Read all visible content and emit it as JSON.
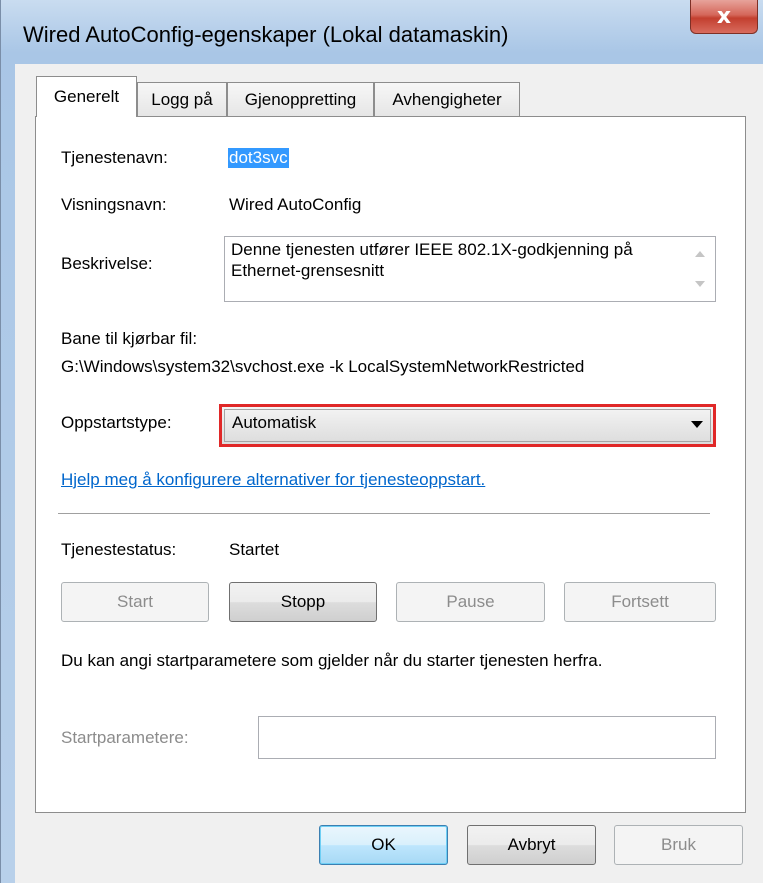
{
  "window": {
    "title": "Wired AutoConfig-egenskaper (Lokal datamaskin)",
    "close_label": "x"
  },
  "tabs": [
    {
      "label": "Generelt"
    },
    {
      "label": "Logg på"
    },
    {
      "label": "Gjenoppretting"
    },
    {
      "label": "Avhengigheter"
    }
  ],
  "general": {
    "service_name_label": "Tjenestenavn:",
    "service_name_value": "dot3svc",
    "display_name_label": "Visningsnavn:",
    "display_name_value": "Wired AutoConfig",
    "description_label": "Beskrivelse:",
    "description_value": "Denne tjenesten utfører IEEE 802.1X-godkjenning på Ethernet-grensesnitt",
    "path_label": "Bane til kjørbar fil:",
    "path_value": "G:\\Windows\\system32\\svchost.exe -k LocalSystemNetworkRestricted",
    "startup_type_label": "Oppstartstype:",
    "startup_type_value": "Automatisk",
    "help_link": "Hjelp meg å konfigurere alternativer for tjenesteoppstart.",
    "status_label": "Tjenestestatus:",
    "status_value": "Startet",
    "buttons": {
      "start": "Start",
      "stop": "Stopp",
      "pause": "Pause",
      "resume": "Fortsett"
    },
    "params_info": "Du kan angi startparametere som gjelder når du starter tjenesten herfra.",
    "params_label": "Startparametere:",
    "params_value": ""
  },
  "footer": {
    "ok": "OK",
    "cancel": "Avbryt",
    "apply": "Bruk"
  },
  "colors": {
    "highlight_border": "#e02828",
    "selection": "#3399ff",
    "link": "#0066cc"
  }
}
